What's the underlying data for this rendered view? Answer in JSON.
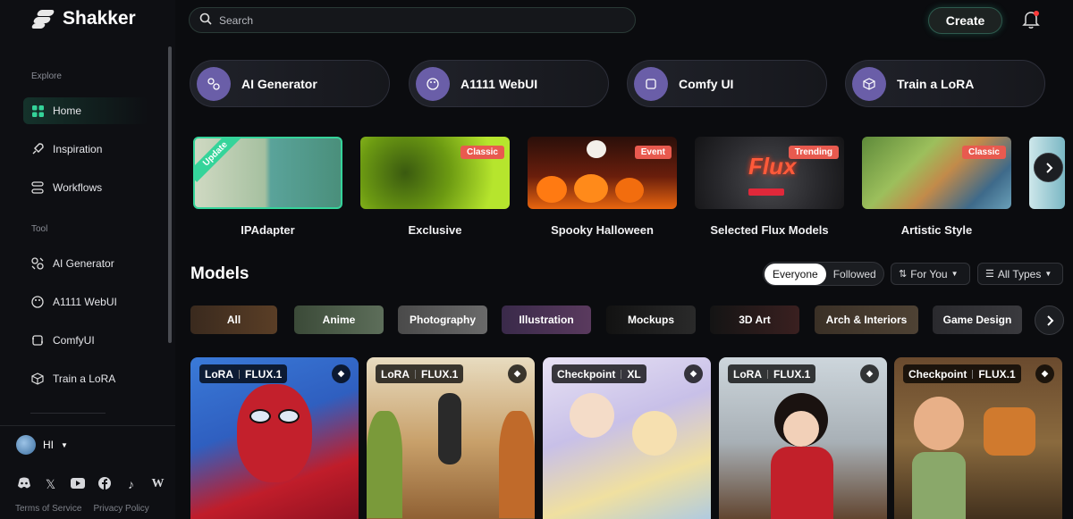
{
  "app": {
    "name": "Shakker"
  },
  "sidebar": {
    "explore_label": "Explore",
    "explore_items": [
      {
        "label": "Home",
        "icon": "grid-icon",
        "active": true
      },
      {
        "label": "Inspiration",
        "icon": "rocket-icon"
      },
      {
        "label": "Workflows",
        "icon": "workflow-icon"
      }
    ],
    "tool_label": "Tool",
    "tool_items": [
      {
        "label": "AI Generator",
        "icon": "ai-generator-icon"
      },
      {
        "label": "A1111 WebUI",
        "icon": "palette-icon"
      },
      {
        "label": "ComfyUI",
        "icon": "comfy-icon"
      },
      {
        "label": "Train a LoRA",
        "icon": "cube-icon"
      }
    ],
    "user_name": "HI",
    "socials": [
      "discord-icon",
      "x-icon",
      "youtube-icon",
      "facebook-icon",
      "tiktok-icon",
      "w-icon"
    ],
    "footer": {
      "terms": "Terms of Service",
      "privacy": "Privacy Policy"
    }
  },
  "search": {
    "placeholder": "Search"
  },
  "header": {
    "create_label": "Create"
  },
  "tool_cards": [
    {
      "label": "AI Generator",
      "icon": "ai-generator-icon"
    },
    {
      "label": "A1111 WebUI",
      "icon": "palette-icon"
    },
    {
      "label": "Comfy UI",
      "icon": "comfy-icon"
    },
    {
      "label": "Train a LoRA",
      "icon": "cube-icon"
    }
  ],
  "collections": [
    {
      "title": "IPAdapter",
      "ribbon": "Update",
      "badge": ""
    },
    {
      "title": "Exclusive",
      "badge": "Classic"
    },
    {
      "title": "Spooky Halloween",
      "badge": "Event"
    },
    {
      "title": "Selected Flux Models",
      "badge": "Trending",
      "overlay_text": "Flux"
    },
    {
      "title": "Artistic Style",
      "badge": "Classic"
    }
  ],
  "models": {
    "title": "Models",
    "toggle": {
      "selected": "Everyone",
      "other": "Followed"
    },
    "sort_label": "For You",
    "type_label": "All Types",
    "categories": [
      "All",
      "Anime",
      "Photography",
      "Illustration",
      "Mockups",
      "3D Art",
      "Arch & Interiors",
      "Game Design"
    ],
    "cards": [
      {
        "type": "LoRA",
        "base": "FLUX.1"
      },
      {
        "type": "LoRA",
        "base": "FLUX.1"
      },
      {
        "type": "Checkpoint",
        "base": "XL"
      },
      {
        "type": "LoRA",
        "base": "FLUX.1"
      },
      {
        "type": "Checkpoint",
        "base": "FLUX.1"
      }
    ]
  },
  "colors": {
    "accent": "#34d399",
    "badge": "#e85a4f",
    "tool_icon_bg": "#6a5ea8"
  }
}
